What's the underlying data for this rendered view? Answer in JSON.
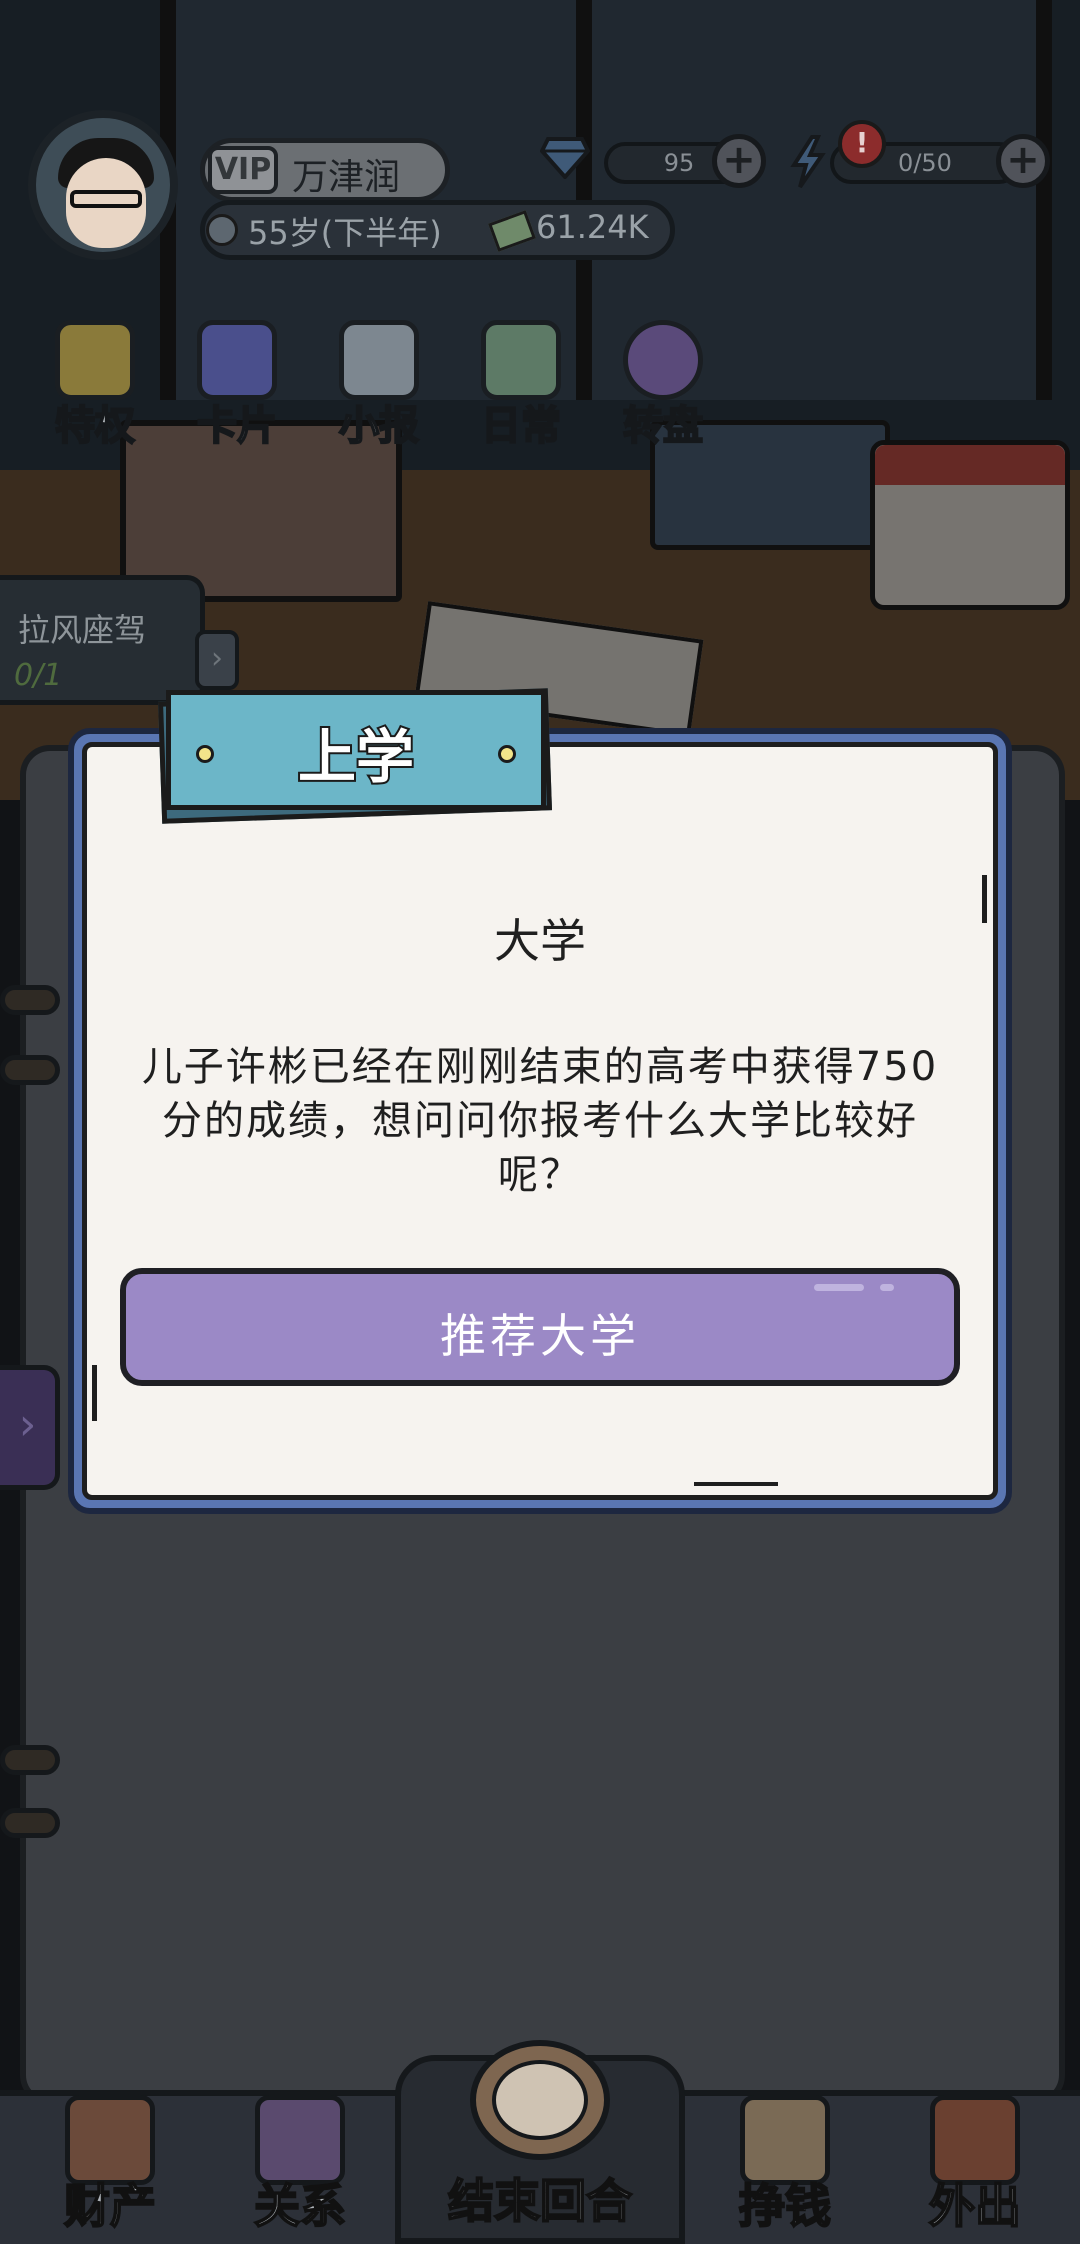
{
  "profile": {
    "vip_label": "VIP",
    "name": "万津润",
    "age": "55岁(下半年)",
    "money": "61.24K"
  },
  "currency": {
    "gems": "95",
    "energy": "0/50",
    "alert_mark": "!"
  },
  "features": [
    {
      "label": "特权",
      "icon": "vip-crown-icon"
    },
    {
      "label": "卡片",
      "icon": "cards-icon"
    },
    {
      "label": "小报",
      "icon": "newspaper-icon"
    },
    {
      "label": "日常",
      "icon": "clipboard-icon"
    },
    {
      "label": "转盘",
      "icon": "wheel-icon"
    }
  ],
  "side_task": {
    "title": "拉风座驾",
    "progress": "0/1"
  },
  "modal": {
    "tag": "上学",
    "heading": "大学",
    "body": "儿子许彬已经在刚刚结束的高考中获得750分的成绩，想问问你报考什么大学比较好呢？",
    "button": "推荐大学"
  },
  "bottom_nav": [
    {
      "label": "财产",
      "icon": "house-icon"
    },
    {
      "label": "关系",
      "icon": "contacts-book-icon"
    },
    {
      "label": "结束回合",
      "icon": "alarm-clock-icon"
    },
    {
      "label": "挣钱",
      "icon": "fist-money-icon"
    },
    {
      "label": "外出",
      "icon": "door-exit-icon"
    }
  ],
  "colors": {
    "modal_frame": "#5a76b3",
    "tag_blue": "#6cb6c8",
    "button_purple": "#9b89c6",
    "paper": "#f6f3ef"
  }
}
